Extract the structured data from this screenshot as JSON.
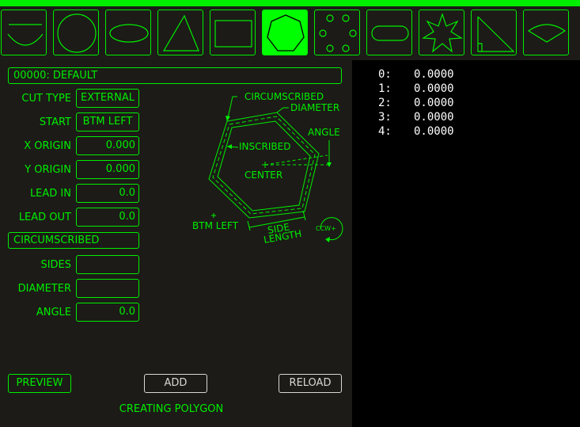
{
  "toolbar": {
    "tools": [
      {
        "name": "arc-chord-tool",
        "active": false
      },
      {
        "name": "circle-tool",
        "active": false
      },
      {
        "name": "ellipse-tool",
        "active": false
      },
      {
        "name": "triangle-tool",
        "active": false
      },
      {
        "name": "rectangle-tool",
        "active": false
      },
      {
        "name": "polygon-tool",
        "active": true
      },
      {
        "name": "bolt-circle-tool",
        "active": false
      },
      {
        "name": "slot-tool",
        "active": false
      },
      {
        "name": "star-tool",
        "active": false
      },
      {
        "name": "right-triangle-tool",
        "active": false
      },
      {
        "name": "sector-tool",
        "active": false
      }
    ]
  },
  "form": {
    "profile": "00000: DEFAULT",
    "cut_type_label": "CUT TYPE",
    "cut_type_value": "EXTERNAL",
    "start_label": "START",
    "start_value": "BTM LEFT",
    "x_origin_label": "X ORIGIN",
    "x_origin_value": "0.000",
    "y_origin_label": "Y ORIGIN",
    "y_origin_value": "0.000",
    "lead_in_label": "LEAD IN",
    "lead_in_value": "0.0",
    "lead_out_label": "LEAD OUT",
    "lead_out_value": "0.0",
    "mode_value": "CIRCUMSCRIBED",
    "sides_label": "SIDES",
    "sides_value": "",
    "diameter_label": "DIAMETER",
    "diameter_value": "",
    "angle_label": "ANGLE",
    "angle_value": "0.0"
  },
  "diagram": {
    "circumscribed": "CIRCUMSCRIBED",
    "diameter": "DIAMETER",
    "angle": "ANGLE",
    "inscribed": "INSCRIBED",
    "center": "CENTER",
    "btm_left": "BTM LEFT",
    "side": "SIDE",
    "length": "LENGTH",
    "ccw": "CCW+"
  },
  "buttons": {
    "preview": "PREVIEW",
    "add": "ADD",
    "reload": "RELOAD"
  },
  "status": "CREATING POLYGON",
  "points": [
    {
      "index": "0:",
      "value": "0.0000"
    },
    {
      "index": "1:",
      "value": "0.0000"
    },
    {
      "index": "2:",
      "value": "0.0000"
    },
    {
      "index": "3:",
      "value": "0.0000"
    },
    {
      "index": "4:",
      "value": "0.0000"
    }
  ],
  "colors": {
    "accent": "#00ee00",
    "active_tool": "#00ff00",
    "panel_bg": "#1c1b17",
    "preview_bg": "#000000"
  }
}
